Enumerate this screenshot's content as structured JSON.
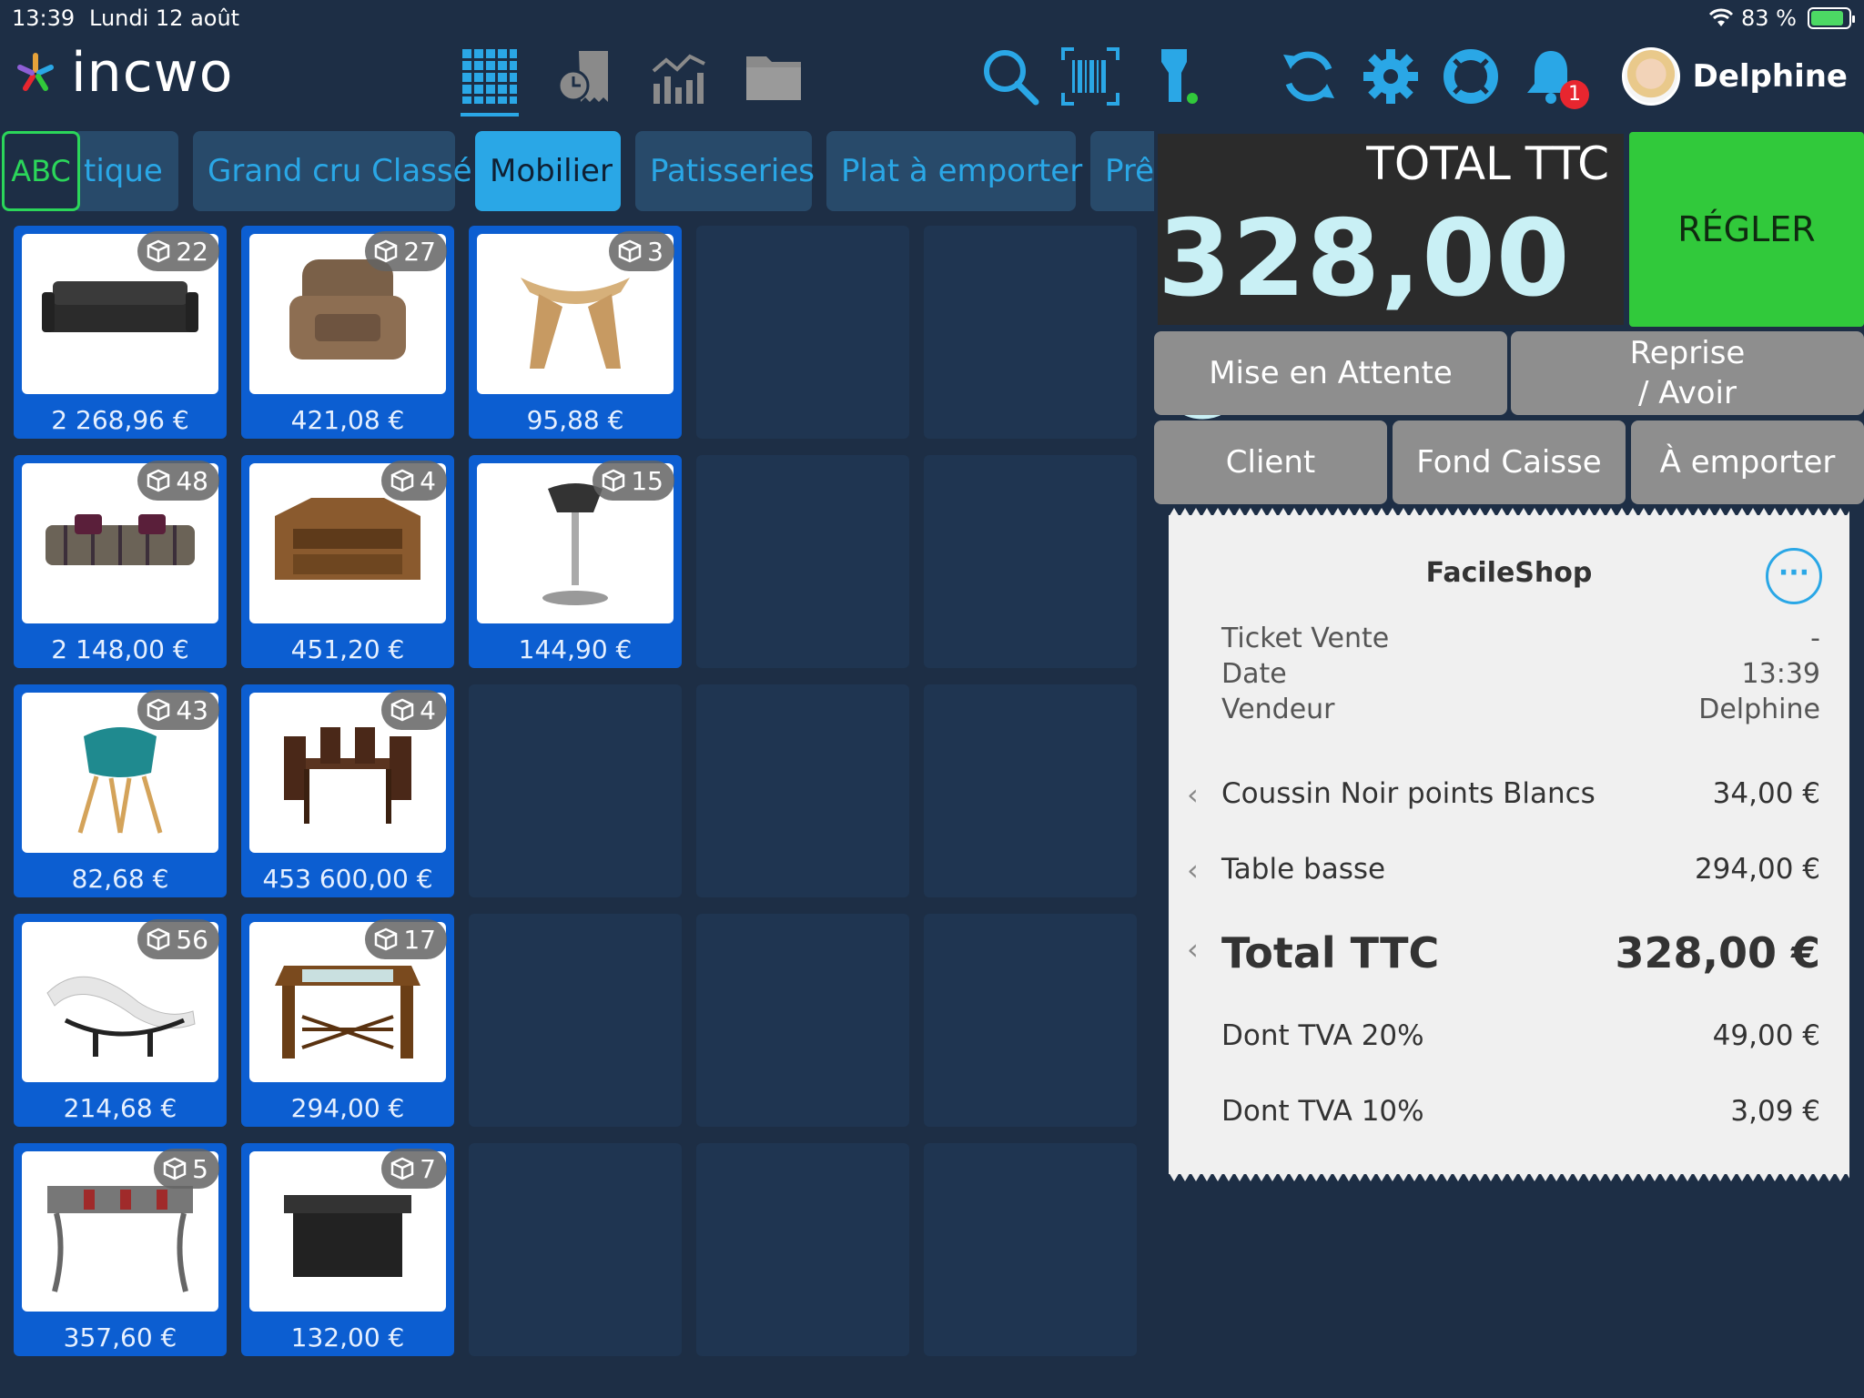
{
  "status": {
    "time": "13:39",
    "date": "Lundi 12 août",
    "battery": "83 %"
  },
  "brand": "incwo",
  "toolbar": {
    "notification_count": "1"
  },
  "user": {
    "name": "Delphine"
  },
  "categories": [
    {
      "label": "ABC"
    },
    {
      "label": "tique"
    },
    {
      "label": "Grand cru Classé"
    },
    {
      "label": "Mobilier",
      "selected": true
    },
    {
      "label": "Patisseries"
    },
    {
      "label": "Plat à emporter"
    },
    {
      "label": "Prê"
    }
  ],
  "products": [
    {
      "stock": "22",
      "price": "2 268,96 €",
      "icon": "sofa-image"
    },
    {
      "stock": "27",
      "price": "421,08 €",
      "icon": "armchair-image"
    },
    {
      "stock": "3",
      "price": "95,88 €",
      "icon": "stool-image"
    },
    {
      "stock": "48",
      "price": "2 148,00 €",
      "icon": "striped-sofa-image"
    },
    {
      "stock": "4",
      "price": "451,20 €",
      "icon": "tv-cabinet-image"
    },
    {
      "stock": "15",
      "price": "144,90 €",
      "icon": "bar-stool-image"
    },
    {
      "stock": "43",
      "price": "82,68 €",
      "icon": "chair-image"
    },
    {
      "stock": "4",
      "price": "453 600,00 €",
      "icon": "dining-set-image"
    },
    {
      "stock": "56",
      "price": "214,68 €",
      "icon": "chaise-longue-image"
    },
    {
      "stock": "17",
      "price": "294,00 €",
      "icon": "coffee-table-image"
    },
    {
      "stock": "5",
      "price": "357,60 €",
      "icon": "console-table-image"
    },
    {
      "stock": "7",
      "price": "132,00 €",
      "icon": "black-table-image"
    }
  ],
  "total": {
    "label": "TOTAL TTC",
    "amount": "328,00 €"
  },
  "actions": {
    "regler": "RÉGLER",
    "hold": "Mise en Attente",
    "refund_line1": "Reprise",
    "refund_line2": "/ Avoir",
    "client": "Client",
    "float": "Fond Caisse",
    "takeaway": "À emporter"
  },
  "ticket": {
    "shop": "FacileShop",
    "meta": [
      {
        "label": "Ticket Vente",
        "value": "-"
      },
      {
        "label": "Date",
        "value": "13:39"
      },
      {
        "label": "Vendeur",
        "value": "Delphine"
      }
    ],
    "lines": [
      {
        "label": "Coussin Noir points Blancs",
        "value": "34,00 €"
      },
      {
        "label": "Table basse",
        "value": "294,00 €"
      }
    ],
    "total": {
      "label": "Total TTC",
      "value": "328,00 €"
    },
    "taxes": [
      {
        "label": "Dont TVA 20%",
        "value": "49,00 €"
      },
      {
        "label": "Dont TVA 10%",
        "value": "3,09 €"
      }
    ]
  },
  "colors": {
    "background": "#1d2e45",
    "accent": "#2aa7e6",
    "product_tile": "#0c5ed1",
    "pay": "#31c93b",
    "badge": "#e8262f"
  }
}
